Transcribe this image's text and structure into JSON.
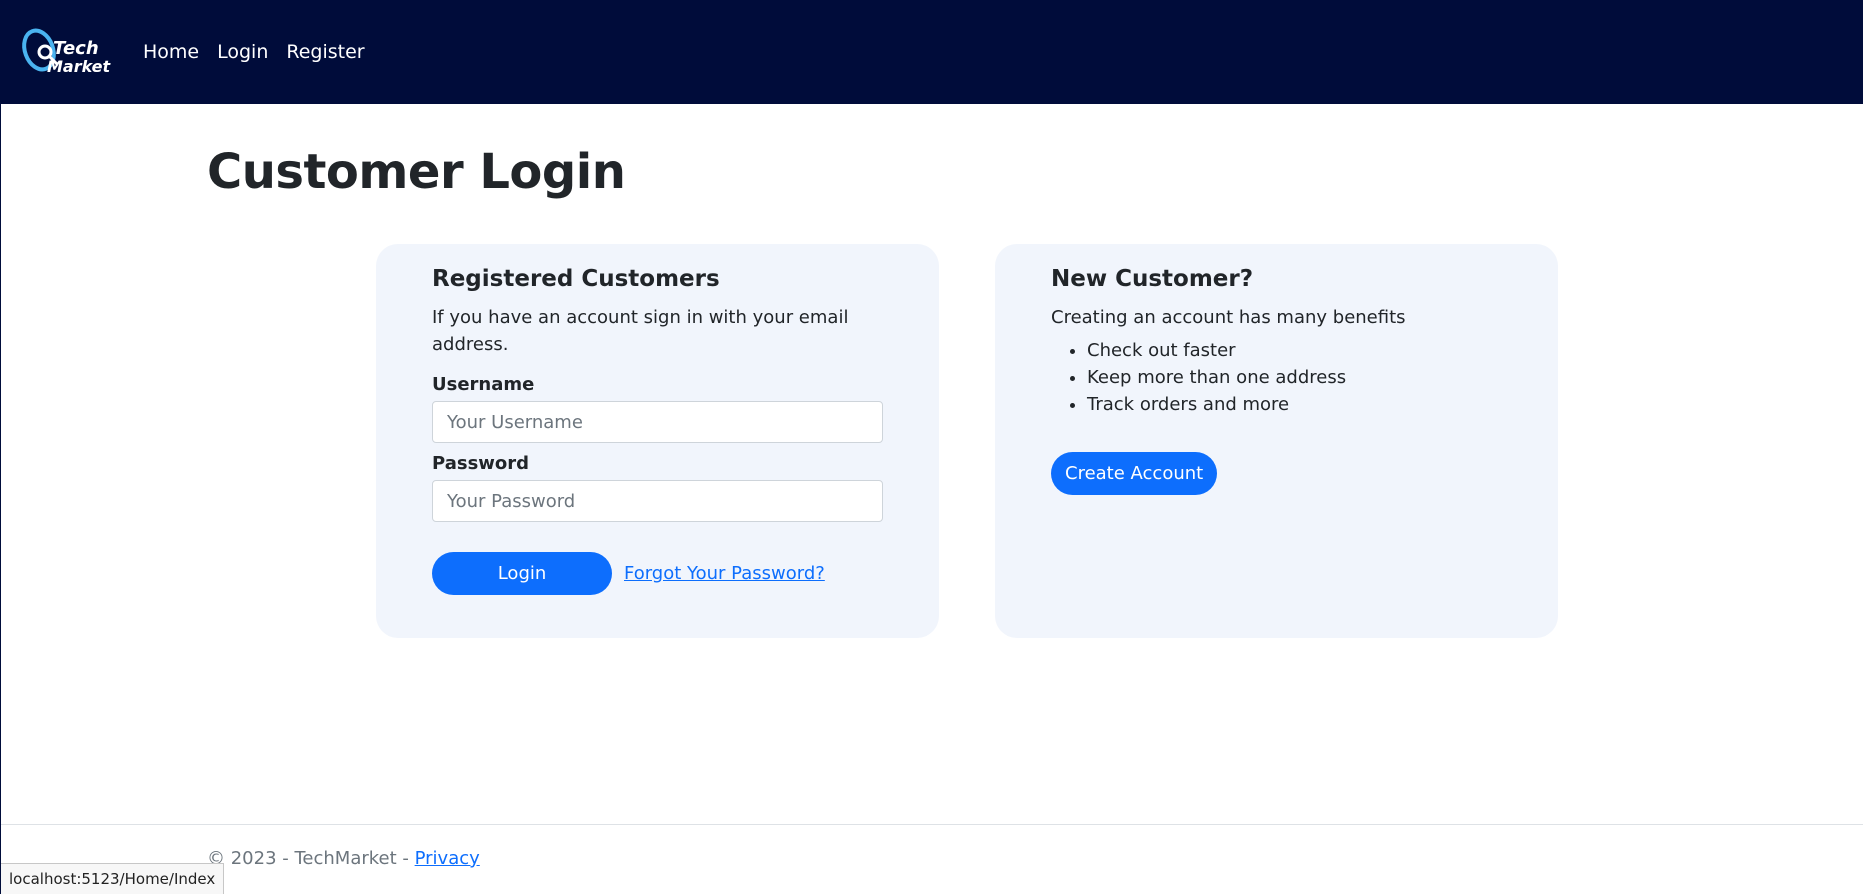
{
  "nav": {
    "logo_text_line1": "Tech",
    "logo_text_line2": "Market",
    "links": [
      "Home",
      "Login",
      "Register"
    ]
  },
  "page_title": "Customer Login",
  "login_card": {
    "heading": "Registered Customers",
    "description": "If you have an account sign in with your email address.",
    "username_label": "Username",
    "username_placeholder": "Your Username",
    "password_label": "Password",
    "password_placeholder": "Your Password",
    "login_button": "Login",
    "forgot_link": "Forgot Your Password?"
  },
  "new_customer_card": {
    "heading": "New Customer?",
    "description": "Creating an account has many benefits",
    "benefits": [
      "Check out faster",
      "Keep more than one address",
      "Track orders and more"
    ],
    "create_button": "Create Account"
  },
  "footer": {
    "copyright": "© 2023 - TechMarket - ",
    "privacy_link": "Privacy"
  },
  "status_bar": "localhost:5123/Home/Index",
  "colors": {
    "navbar": "#000c3a",
    "primary": "#0d6efd",
    "card_bg": "#f1f5fc"
  }
}
